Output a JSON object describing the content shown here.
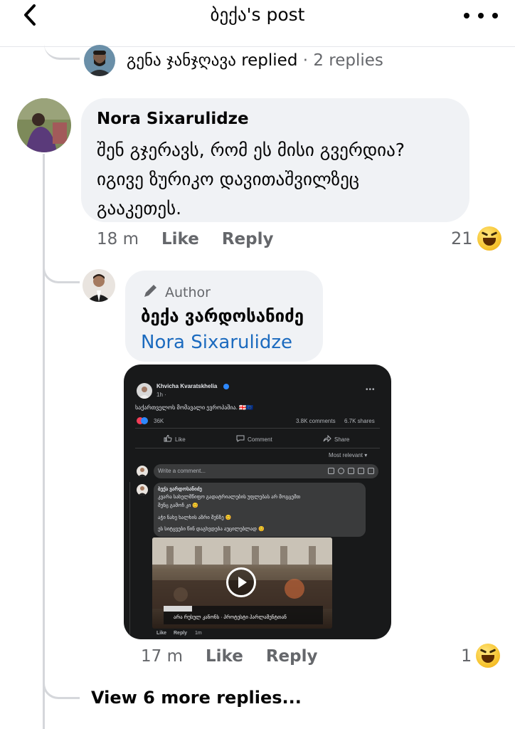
{
  "header": {
    "title": "ბექა's post"
  },
  "replied_row": {
    "name": "გენა ჯანჯღავა",
    "action": "replied",
    "separator": "·",
    "count": "2 replies"
  },
  "comment1": {
    "author": "Nora Sixarulidze",
    "lines": [
      "შენ გჯერავს, რომ ეს მისი გვერდია?",
      "იგივე ზურიკო დავითაშვილზეც",
      "გააკეთეს."
    ],
    "time": "18 m",
    "like_label": "Like",
    "reply_label": "Reply",
    "reaction_count": "21"
  },
  "comment2": {
    "badge": "Author",
    "author": "ბექა ვარდოსანიძე",
    "mention": "Nora Sixarulidze",
    "time": "17 m",
    "like_label": "Like",
    "reply_label": "Reply",
    "reaction_count": "1"
  },
  "embedded_post": {
    "author": "Khvicha Kvaratskhelia",
    "time": "1h · ",
    "text": "საქართველოს მომავალი ევროპაშია. 🇬🇪🇪🇺",
    "reactions": "36K",
    "comments": "3.8K comments",
    "shares": "6.7K shares",
    "like": "Like",
    "comment": "Comment",
    "share": "Share",
    "sort": "Most relevant ▾",
    "input_placeholder": "Write a comment...",
    "reply_author": "ბექა ვარდოსანიძე",
    "reply_lines": [
      "კვარა სახელმწიფო გადატრიალების უფლებას არ მოგცემთ",
      "შენც გამოჩ კი 😊",
      "აჭი ნახე ხალხის აზრი შენზე 😊",
      "ეს სიტყვები წინ დაგხვდება აუცილებლად 😊"
    ],
    "video_caption": "არა რუსულ კანონს · პროტესტი პარლამენტთან",
    "meta_like": "Like",
    "meta_reply": "Reply",
    "meta_time": "1m"
  },
  "view_more": "View 6 more replies...",
  "colors": {
    "bubble": "#f0f2f5",
    "link": "#1c6bbf",
    "muted": "#65676b",
    "dark_card": "#18191a"
  },
  "icons": [
    "back-arrow-icon",
    "more-dots-icon",
    "pencil-icon",
    "haha-emoji-icon",
    "play-icon"
  ]
}
